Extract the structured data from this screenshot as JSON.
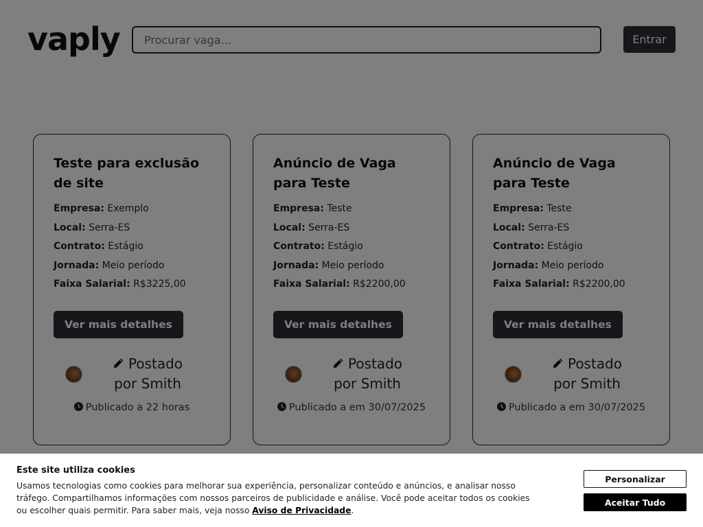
{
  "header": {
    "logo": "vaply",
    "search_placeholder": "Procurar vaga...",
    "login_label": "Entrar"
  },
  "field_labels": {
    "company": "Empresa:",
    "location": "Local:",
    "contract": "Contrato:",
    "schedule": "Jornada:",
    "salary": "Faixa Salarial:"
  },
  "cards": [
    {
      "title": "Teste para exclusão de site",
      "company": "Exemplo",
      "location": "Serra-ES",
      "contract": "Estágio",
      "schedule": "Meio período",
      "salary": "R$3225,00",
      "button": "Ver mais detalhes",
      "posted_by": "Postado por Smith",
      "published": "Publicado a 22 horas"
    },
    {
      "title": "Anúncio de Vaga para Teste",
      "company": "Teste",
      "location": "Serra-ES",
      "contract": "Estágio",
      "schedule": "Meio período",
      "salary": "R$2200,00",
      "button": "Ver mais detalhes",
      "posted_by": "Postado por Smith",
      "published": "Publicado a em 30/07/2025"
    },
    {
      "title": "Anúncio de Vaga para Teste",
      "company": "Teste",
      "location": "Serra-ES",
      "contract": "Estágio",
      "schedule": "Meio período",
      "salary": "R$2200,00",
      "button": "Ver mais detalhes",
      "posted_by": "Postado por Smith",
      "published": "Publicado a em 30/07/2025"
    }
  ],
  "cookie_banner": {
    "title": "Este site utiliza cookies",
    "text": "Usamos tecnologias como cookies para melhorar sua experiência, personalizar conteúdo e anúncios, e analisar nosso tráfego. Compartilhamos informações com nossos parceiros de publicidade e análise. Você pode aceitar todos os cookies ou escolher quais permitir. Para saber mais, veja nosso",
    "privacy_link": "Aviso de Privacidade",
    "period": ".",
    "customize_label": "Personalizar",
    "accept_label": "Aceitar Tudo"
  },
  "icons": {
    "edit": "pencil-icon",
    "time": "clock-icon"
  }
}
